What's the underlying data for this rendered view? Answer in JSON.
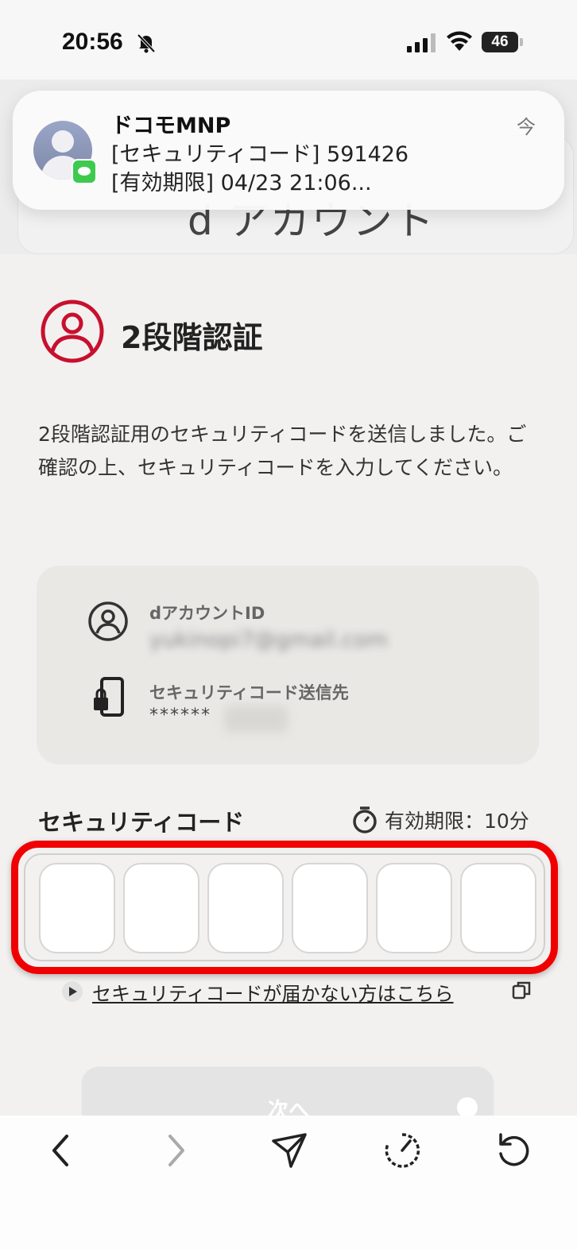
{
  "status_bar": {
    "time": "20:56",
    "battery": "46"
  },
  "notification": {
    "sender": "ドコモMNP",
    "line1": "[セキュリティコード] 591426",
    "line2": "[有効期限] 04/23 21:06...",
    "time": "今"
  },
  "header": {
    "logo": "d アカウント"
  },
  "page": {
    "title": "2段階認証",
    "description": "2段階認証用のセキュリティコードを送信しました。ご確認の上、セキュリティコードを入力してください。"
  },
  "info": {
    "account_label": "dアカウントID",
    "account_value": "yukinopi7@gmail.com",
    "destination_label": "セキュリティコード送信先",
    "destination_value": "******"
  },
  "code": {
    "label": "セキュリティコード",
    "expiry": "有効期限：10分",
    "digits": [
      "",
      "",
      "",
      "",
      "",
      ""
    ]
  },
  "help_link": "セキュリティコードが届かない方はこちら",
  "next_button": "次へ",
  "colors": {
    "accent": "#c8102e",
    "highlight": "#f00000",
    "background": "#f2f1f0"
  },
  "icons": {
    "back": "chevron-left-icon",
    "forward": "chevron-right-icon",
    "share": "send-icon",
    "speed": "gauge-icon",
    "reload": "reload-icon"
  }
}
